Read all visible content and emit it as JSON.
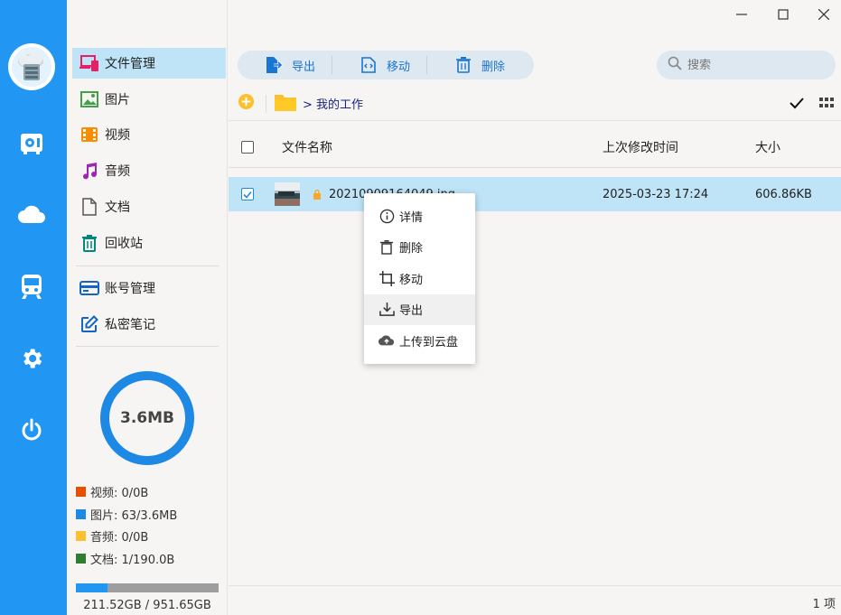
{
  "sidebar": {
    "items": [
      {
        "label": "文件管理",
        "icon": "devices-icon"
      },
      {
        "label": "图片",
        "icon": "image-icon"
      },
      {
        "label": "视频",
        "icon": "film-icon"
      },
      {
        "label": "音频",
        "icon": "music-icon"
      },
      {
        "label": "文档",
        "icon": "document-icon"
      },
      {
        "label": "回收站",
        "icon": "trash-icon"
      },
      {
        "label": "账号管理",
        "icon": "card-icon"
      },
      {
        "label": "私密笔记",
        "icon": "edit-note-icon"
      }
    ],
    "storage_used_label": "3.6MB",
    "legend": [
      {
        "label": "视频: 0/0B",
        "color": "#e65100"
      },
      {
        "label": "图片: 63/3.6MB",
        "color": "#1e88e5"
      },
      {
        "label": "音频: 0/0B",
        "color": "#fbc02d"
      },
      {
        "label": "文档: 1/190.0B",
        "color": "#2e7d32"
      }
    ],
    "disk_usage_fraction": 0.222,
    "disk_text": "211.52GB / 951.65GB"
  },
  "toolbar": {
    "export_label": "导出",
    "move_label": "移动",
    "delete_label": "删除"
  },
  "search": {
    "placeholder": "搜索"
  },
  "path": {
    "crumb": "> 我的工作"
  },
  "table": {
    "col_name": "文件名称",
    "col_time": "上次修改时间",
    "col_size": "大小",
    "rows": [
      {
        "name": "20210909164049.jpg",
        "time": "2025-03-23 17:24",
        "size": "606.86KB"
      }
    ]
  },
  "context_menu": {
    "items": [
      {
        "label": "详情",
        "icon": "info-icon"
      },
      {
        "label": "删除",
        "icon": "trash-icon"
      },
      {
        "label": "移动",
        "icon": "crop-move-icon"
      },
      {
        "label": "导出",
        "icon": "download-icon"
      },
      {
        "label": "上传到云盘",
        "icon": "cloud-upload-icon"
      }
    ]
  },
  "footer": {
    "count": "1 项"
  },
  "colors": {
    "accent": "#2196f3",
    "selection": "#bfe3f7"
  }
}
